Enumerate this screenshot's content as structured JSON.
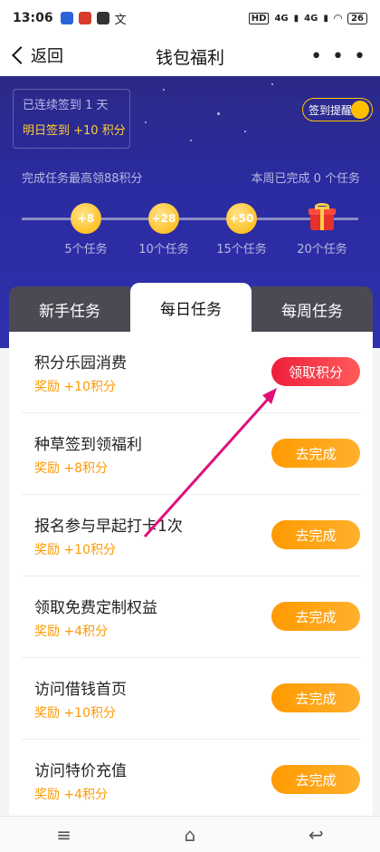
{
  "status": {
    "time": "13:06",
    "network1": "4G",
    "network2": "4G",
    "battery": "26"
  },
  "nav": {
    "back_label": "返回",
    "title": "钱包福利",
    "more_label": "• • •"
  },
  "hero": {
    "streak_line1": "已连续签到 1 天",
    "streak_line2": "明日签到 +10 积分",
    "remind_label": "签到提醒",
    "left_text": "完成任务最高领88积分",
    "right_text": "本周已完成 0 个任务",
    "milestones": [
      {
        "value": "+8",
        "label": "5个任务"
      },
      {
        "value": "+28",
        "label": "10个任务"
      },
      {
        "value": "+50",
        "label": "15个任务"
      },
      {
        "value": "gift-icon",
        "label": "20个任务"
      }
    ]
  },
  "tabs": [
    {
      "label": "新手任务",
      "active": false
    },
    {
      "label": "每日任务",
      "active": true
    },
    {
      "label": "每周任务",
      "active": false
    }
  ],
  "tasks": [
    {
      "title": "积分乐园消费",
      "reward": "奖励 +10积分",
      "button": "领取积分",
      "button_type": "claim"
    },
    {
      "title": "种草签到领福利",
      "reward": "奖励 +8积分",
      "button": "去完成",
      "button_type": "do"
    },
    {
      "title": "报名参与早起打卡1次",
      "reward": "奖励 +10积分",
      "button": "去完成",
      "button_type": "do"
    },
    {
      "title": "领取免费定制权益",
      "reward": "奖励 +4积分",
      "button": "去完成",
      "button_type": "do"
    },
    {
      "title": "访问借钱首页",
      "reward": "奖励 +10积分",
      "button": "去完成",
      "button_type": "do"
    },
    {
      "title": "访问特价充值",
      "reward": "奖励 +4积分",
      "button": "去完成",
      "button_type": "do"
    }
  ],
  "bottom_nav": {
    "menu_icon": "≡",
    "home_icon": "⌂",
    "back_icon": "↩"
  },
  "colors": {
    "hero_bg": "#2b2a87",
    "accent_orange": "#ff9a00",
    "claim_red": "#ee1f3a"
  }
}
